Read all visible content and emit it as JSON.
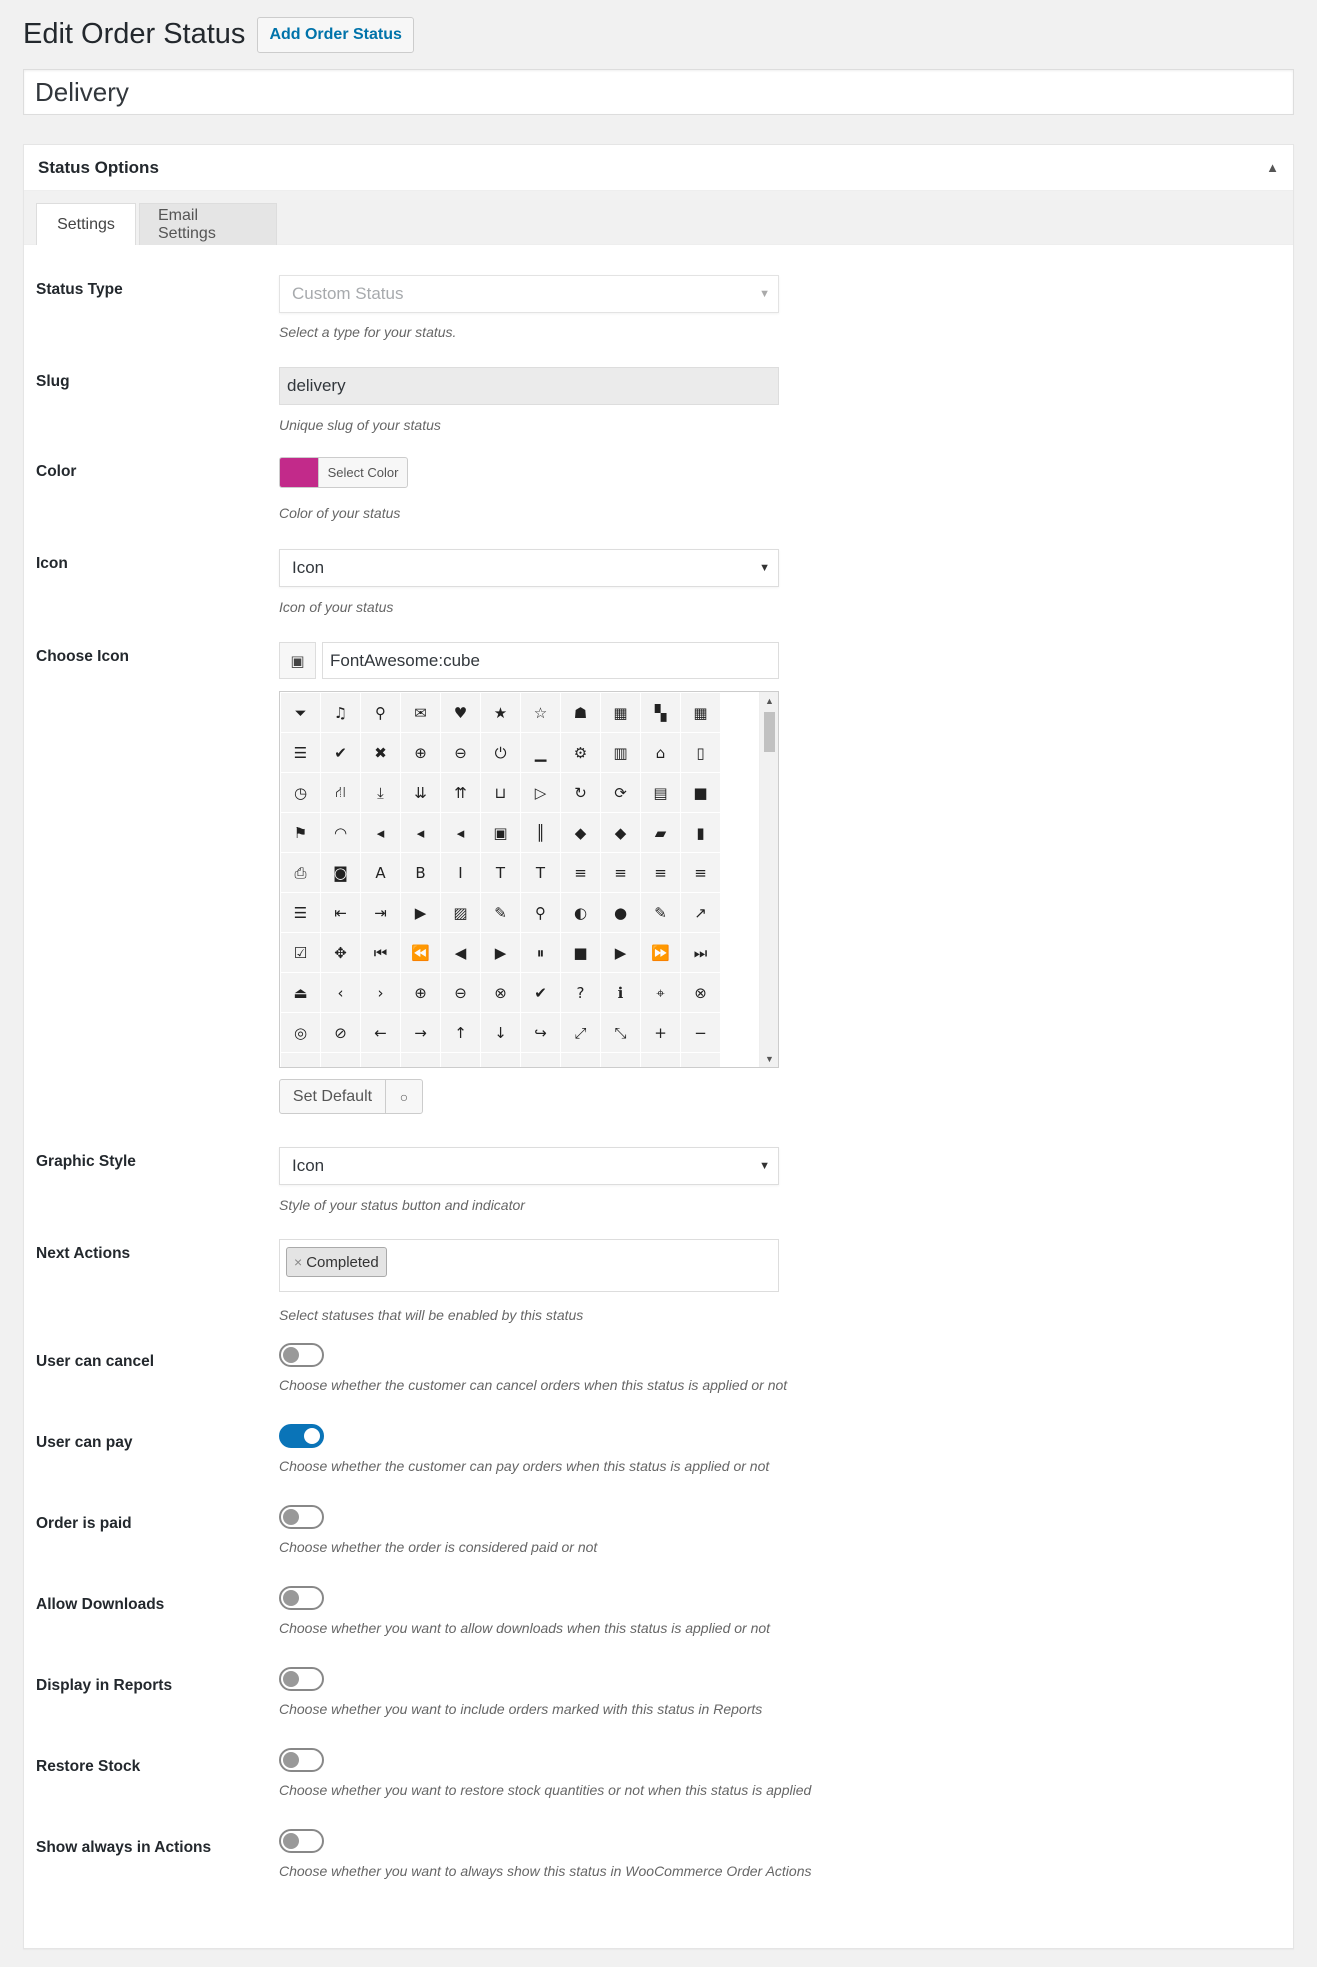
{
  "header": {
    "title": "Edit Order Status",
    "add_button": "Add Order Status"
  },
  "post_title": "Delivery",
  "metabox": {
    "title": "Status Options",
    "tabs": [
      {
        "label": "Settings",
        "active": true
      },
      {
        "label": "Email Settings",
        "active": false
      }
    ]
  },
  "fields": {
    "status_type": {
      "label": "Status Type",
      "value": "Custom Status",
      "desc": "Select a type for your status."
    },
    "slug": {
      "label": "Slug",
      "value": "delivery",
      "desc": "Unique slug of your status"
    },
    "color": {
      "label": "Color",
      "button": "Select Color",
      "value": "#c22a8a",
      "desc": "Color of your status"
    },
    "icon": {
      "label": "Icon",
      "value": "Icon",
      "desc": "Icon of your status"
    },
    "choose_icon": {
      "label": "Choose Icon",
      "value": "FontAwesome:cube",
      "preview_icon": "cube-icon",
      "set_default": "Set Default",
      "clear_symbol": "○",
      "icons": [
        {
          "name": "filter-icon",
          "glyph": "⏷"
        },
        {
          "name": "music-icon",
          "glyph": "♫"
        },
        {
          "name": "search-icon",
          "glyph": "⚲"
        },
        {
          "name": "envelope-icon",
          "glyph": "✉"
        },
        {
          "name": "heart-icon",
          "glyph": "♥"
        },
        {
          "name": "star-icon",
          "glyph": "★"
        },
        {
          "name": "star-outline-icon",
          "glyph": "☆"
        },
        {
          "name": "user-icon",
          "glyph": "☗"
        },
        {
          "name": "film-icon",
          "glyph": "▦"
        },
        {
          "name": "th-large-icon",
          "glyph": "▚"
        },
        {
          "name": "th-icon",
          "glyph": "▦"
        },
        {
          "name": "th-list-icon",
          "glyph": "☰"
        },
        {
          "name": "check-icon",
          "glyph": "✔"
        },
        {
          "name": "times-icon",
          "glyph": "✖"
        },
        {
          "name": "zoom-in-icon",
          "glyph": "⊕"
        },
        {
          "name": "zoom-out-icon",
          "glyph": "⊖"
        },
        {
          "name": "power-icon",
          "glyph": "⏻"
        },
        {
          "name": "signal-icon",
          "glyph": "▁"
        },
        {
          "name": "cog-icon",
          "glyph": "⚙"
        },
        {
          "name": "trash-icon",
          "glyph": "▥"
        },
        {
          "name": "home-icon",
          "glyph": "⌂"
        },
        {
          "name": "file-icon",
          "glyph": "▯"
        },
        {
          "name": "clock-icon",
          "glyph": "◷"
        },
        {
          "name": "road-icon",
          "glyph": "⛙"
        },
        {
          "name": "download-icon",
          "glyph": "⤓"
        },
        {
          "name": "arrow-circle-down-icon",
          "glyph": "⇊"
        },
        {
          "name": "arrow-circle-up-icon",
          "glyph": "⇈"
        },
        {
          "name": "inbox-icon",
          "glyph": "⊔"
        },
        {
          "name": "play-circle-icon",
          "glyph": "▷"
        },
        {
          "name": "repeat-icon",
          "glyph": "↻"
        },
        {
          "name": "refresh-icon",
          "glyph": "⟳"
        },
        {
          "name": "list-alt-icon",
          "glyph": "▤"
        },
        {
          "name": "lock-icon",
          "glyph": "■"
        },
        {
          "name": "flag-icon",
          "glyph": "⚑"
        },
        {
          "name": "headphones-icon",
          "glyph": "◠"
        },
        {
          "name": "volume-off-icon",
          "glyph": "◂"
        },
        {
          "name": "volume-down-icon",
          "glyph": "◂"
        },
        {
          "name": "volume-up-icon",
          "glyph": "◂"
        },
        {
          "name": "qrcode-icon",
          "glyph": "▣"
        },
        {
          "name": "barcode-icon",
          "glyph": "║"
        },
        {
          "name": "tag-icon",
          "glyph": "◆"
        },
        {
          "name": "tags-icon",
          "glyph": "◆"
        },
        {
          "name": "book-icon",
          "glyph": "▰"
        },
        {
          "name": "bookmark-icon",
          "glyph": "▮"
        },
        {
          "name": "print-icon",
          "glyph": "⎙"
        },
        {
          "name": "camera-icon",
          "glyph": "◙"
        },
        {
          "name": "font-icon",
          "glyph": "A"
        },
        {
          "name": "bold-icon",
          "glyph": "B"
        },
        {
          "name": "italic-icon",
          "glyph": "I"
        },
        {
          "name": "text-height-icon",
          "glyph": "T"
        },
        {
          "name": "text-width-icon",
          "glyph": "T"
        },
        {
          "name": "align-left-icon",
          "glyph": "≡"
        },
        {
          "name": "align-center-icon",
          "glyph": "≡"
        },
        {
          "name": "align-right-icon",
          "glyph": "≡"
        },
        {
          "name": "align-justify-icon",
          "glyph": "≡"
        },
        {
          "name": "list-icon",
          "glyph": "☰"
        },
        {
          "name": "outdent-icon",
          "glyph": "⇤"
        },
        {
          "name": "indent-icon",
          "glyph": "⇥"
        },
        {
          "name": "video-camera-icon",
          "glyph": "▶"
        },
        {
          "name": "picture-icon",
          "glyph": "▨"
        },
        {
          "name": "pencil-icon",
          "glyph": "✎"
        },
        {
          "name": "map-marker-icon",
          "glyph": "⚲"
        },
        {
          "name": "adjust-icon",
          "glyph": "◐"
        },
        {
          "name": "tint-icon",
          "glyph": "●"
        },
        {
          "name": "edit-icon",
          "glyph": "✎"
        },
        {
          "name": "share-icon",
          "glyph": "↗"
        },
        {
          "name": "check-square-icon",
          "glyph": "☑"
        },
        {
          "name": "arrows-icon",
          "glyph": "✥"
        },
        {
          "name": "step-backward-icon",
          "glyph": "⏮"
        },
        {
          "name": "fast-backward-icon",
          "glyph": "⏪"
        },
        {
          "name": "backward-icon",
          "glyph": "◀"
        },
        {
          "name": "play-icon",
          "glyph": "▶"
        },
        {
          "name": "pause-icon",
          "glyph": "⏸"
        },
        {
          "name": "stop-icon",
          "glyph": "■"
        },
        {
          "name": "forward-icon",
          "glyph": "▶"
        },
        {
          "name": "fast-forward-icon",
          "glyph": "⏩"
        },
        {
          "name": "step-forward-icon",
          "glyph": "⏭"
        },
        {
          "name": "eject-icon",
          "glyph": "⏏"
        },
        {
          "name": "chevron-left-icon",
          "glyph": "‹"
        },
        {
          "name": "chevron-right-icon",
          "glyph": "›"
        },
        {
          "name": "plus-circle-icon",
          "glyph": "⊕"
        },
        {
          "name": "minus-circle-icon",
          "glyph": "⊖"
        },
        {
          "name": "times-circle-icon",
          "glyph": "⊗"
        },
        {
          "name": "check-circle-icon",
          "glyph": "✔"
        },
        {
          "name": "question-circle-icon",
          "glyph": "?"
        },
        {
          "name": "info-circle-icon",
          "glyph": "ℹ"
        },
        {
          "name": "crosshairs-icon",
          "glyph": "⌖"
        },
        {
          "name": "times-circle-outline-icon",
          "glyph": "⊗"
        },
        {
          "name": "check-circle-outline-icon",
          "glyph": "◎"
        },
        {
          "name": "ban-icon",
          "glyph": "⊘"
        },
        {
          "name": "arrow-left-icon",
          "glyph": "←"
        },
        {
          "name": "arrow-right-icon",
          "glyph": "→"
        },
        {
          "name": "arrow-up-icon",
          "glyph": "↑"
        },
        {
          "name": "arrow-down-icon",
          "glyph": "↓"
        },
        {
          "name": "mail-forward-icon",
          "glyph": "↪"
        },
        {
          "name": "expand-icon",
          "glyph": "⤢"
        },
        {
          "name": "compress-icon",
          "glyph": "⤡"
        },
        {
          "name": "plus-icon",
          "glyph": "+"
        },
        {
          "name": "minus-icon",
          "glyph": "−"
        },
        {
          "name": "asterisk-icon",
          "glyph": "∗"
        },
        {
          "name": "exclamation-circle-icon",
          "glyph": "!"
        },
        {
          "name": "gift-icon",
          "glyph": "▣"
        },
        {
          "name": "leaf-icon",
          "glyph": "❦"
        },
        {
          "name": "fire-icon",
          "glyph": "♨"
        },
        {
          "name": "eye-icon",
          "glyph": "◉"
        },
        {
          "name": "eye-slash-icon",
          "glyph": "◌"
        },
        {
          "name": "warning-icon",
          "glyph": "▲"
        },
        {
          "name": "plane-icon",
          "glyph": "✈"
        },
        {
          "name": "calendar-icon",
          "glyph": "▦"
        },
        {
          "name": "random-icon",
          "glyph": "⤮"
        }
      ]
    },
    "graphic_style": {
      "label": "Graphic Style",
      "value": "Icon",
      "desc": "Style of your status button and indicator"
    },
    "next_actions": {
      "label": "Next Actions",
      "tag": "Completed",
      "tag_remove": "×",
      "desc": "Select statuses that will be enabled by this status"
    },
    "toggles": [
      {
        "key": "user-can-cancel",
        "label": "User can cancel",
        "on": false,
        "desc": "Choose whether the customer can cancel orders when this status is applied or not"
      },
      {
        "key": "user-can-pay",
        "label": "User can pay",
        "on": true,
        "desc": "Choose whether the customer can pay orders when this status is applied or not"
      },
      {
        "key": "order-is-paid",
        "label": "Order is paid",
        "on": false,
        "desc": "Choose whether the order is considered paid or not"
      },
      {
        "key": "allow-downloads",
        "label": "Allow Downloads",
        "on": false,
        "desc": "Choose whether you want to allow downloads when this status is applied or not"
      },
      {
        "key": "display-in-reports",
        "label": "Display in Reports",
        "on": false,
        "desc": "Choose whether you want to include orders marked with this status in Reports"
      },
      {
        "key": "restore-stock",
        "label": "Restore Stock",
        "on": false,
        "desc": "Choose whether you want to restore stock quantities or not when this status is applied"
      },
      {
        "key": "show-always-in-actions",
        "label": "Show always in Actions",
        "on": false,
        "desc": "Choose whether you want to always show this status in WooCommerce Order Actions"
      }
    ]
  }
}
